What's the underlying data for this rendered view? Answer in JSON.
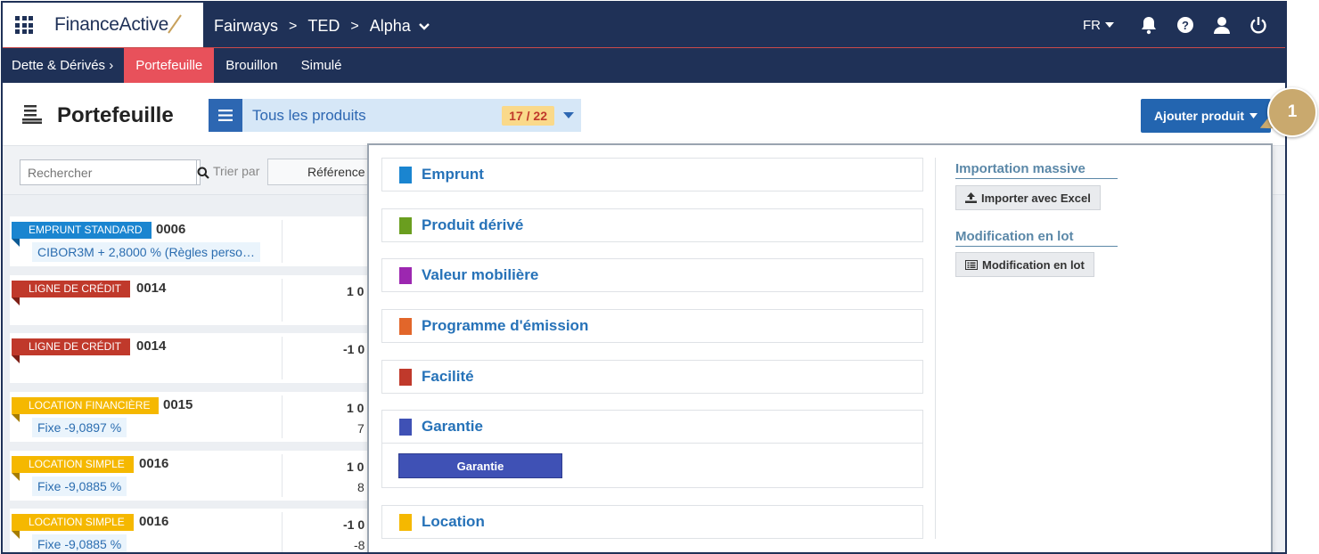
{
  "app": {
    "logo_text": "FinanceActive"
  },
  "breadcrumb": {
    "item1": "Fairways",
    "item2": "TED",
    "item3": "Alpha"
  },
  "header_right": {
    "language": "FR"
  },
  "nav": {
    "section": "Dette & Dérivés ›",
    "tabs": [
      "Portefeuille",
      "Brouillon",
      "Simulé"
    ],
    "active_tab": "Portefeuille"
  },
  "page": {
    "title": "Portefeuille",
    "filter_label": "Tous les produits",
    "filter_count": "17 / 22",
    "add_button": "Ajouter produit"
  },
  "toolbar": {
    "search_placeholder": "Rechercher",
    "sort_label": "Trier par",
    "sort_value": "Référence"
  },
  "rows": [
    {
      "tag": "EMPRUNT STANDARD",
      "tag_color": "#1a85d0",
      "number": "0006",
      "rate": "CIBOR3M + 2,8000 % (Règles perso…",
      "amount": "",
      "sub": ""
    },
    {
      "tag": "LIGNE DE CRÉDIT",
      "tag_color": "#c0392b",
      "number": "0014",
      "rate": "",
      "amount": "1 0",
      "sub": ""
    },
    {
      "tag": "LIGNE DE CRÉDIT",
      "tag_color": "#c0392b",
      "number": "0014",
      "rate": "",
      "amount": "-1 0",
      "sub": ""
    },
    {
      "tag": "LOCATION FINANCIÈRE",
      "tag_color": "#f5b800",
      "number": "0015",
      "rate": "Fixe -9,0897 %",
      "amount": "1 0",
      "sub": "7"
    },
    {
      "tag": "LOCATION SIMPLE",
      "tag_color": "#f5b800",
      "number": "0016",
      "rate": "Fixe -9,0885 %",
      "amount": "1 0",
      "sub": "8"
    },
    {
      "tag": "LOCATION SIMPLE",
      "tag_color": "#f5b800",
      "number": "0016",
      "rate": "Fixe -9,0885 %",
      "amount": "-1 0",
      "sub": "-8"
    }
  ],
  "products": [
    {
      "label": "Emprunt",
      "color": "#1a85d0"
    },
    {
      "label": "Produit dérivé",
      "color": "#6a9e1f"
    },
    {
      "label": "Valeur mobilière",
      "color": "#9c27b0"
    },
    {
      "label": "Programme d'émission",
      "color": "#e2662a"
    },
    {
      "label": "Facilité",
      "color": "#c0392b"
    },
    {
      "label": "Garantie",
      "color": "#3f51b5"
    },
    {
      "label": "Location",
      "color": "#f5b800"
    }
  ],
  "garantie_sub_button": "Garantie",
  "side_sections": {
    "import_title": "Importation massive",
    "import_button": "Importer avec Excel",
    "batch_title": "Modification en lot",
    "batch_button": "Modification en lot"
  },
  "callout": "1"
}
